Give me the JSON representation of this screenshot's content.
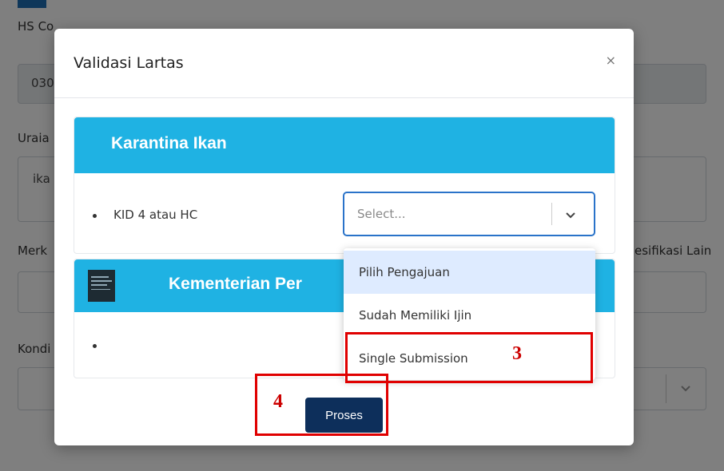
{
  "background": {
    "labels": {
      "hs_code": "HS Co",
      "uraian": "Uraia",
      "merk": "Merk",
      "kondisi": "Kondi",
      "spesifikasi": "esifikasi Lain"
    },
    "fields": {
      "hs_code_value": "030",
      "uraian_value": "ika"
    }
  },
  "modal": {
    "title": "Validasi Lartas",
    "close_label": "×",
    "sections": [
      {
        "title": "Karantina Ikan",
        "items": [
          {
            "label": "KID 4 atau HC"
          }
        ]
      },
      {
        "title": "Kementerian Per",
        "items": [
          {
            "label": ""
          }
        ]
      }
    ],
    "select": {
      "placeholder": "Select...",
      "options": [
        "Pilih Pengajuan",
        "Sudah Memiliki Ijin",
        "Single Submission"
      ],
      "highlighted_option": "Pilih Pengajuan"
    },
    "submit_label": "Proses"
  },
  "annotations": [
    {
      "number": "3",
      "target": "Single Submission"
    },
    {
      "number": "4",
      "target": "Proses"
    }
  ],
  "colors": {
    "section_header": "#1fb2e3",
    "button": "#0d2f5b",
    "highlight": "#deebff",
    "annotation": "#e00000"
  },
  "icons": {
    "close": "close-icon",
    "chevron": "chevron-down-icon",
    "logo": "ministry-logo-icon"
  }
}
